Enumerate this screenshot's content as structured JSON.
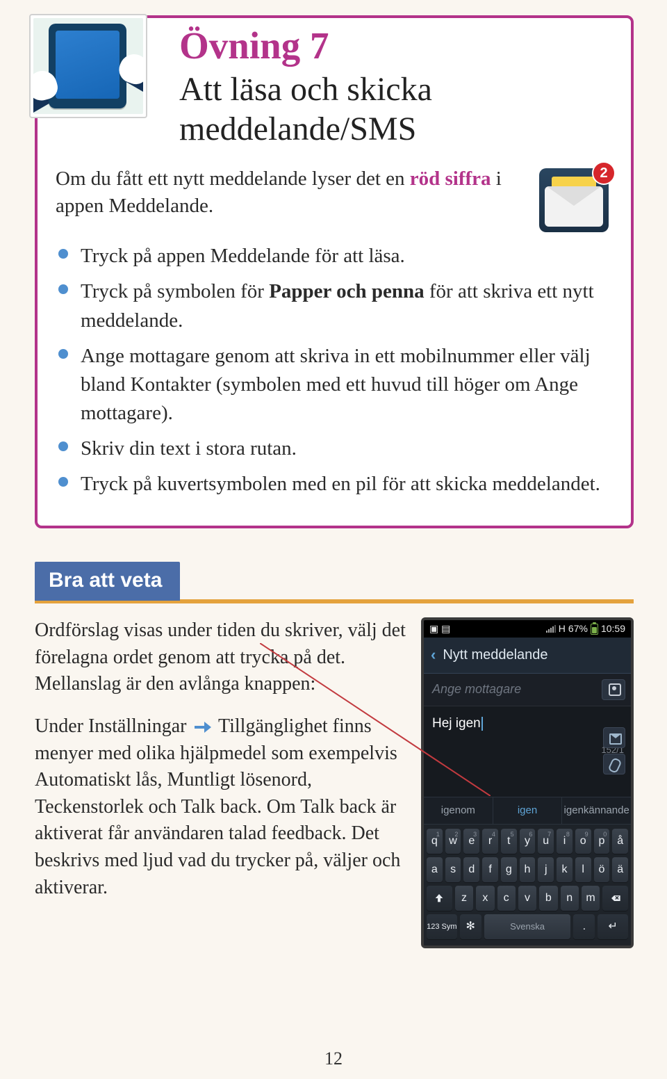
{
  "exercise": {
    "title": "Övning 7",
    "subtitle_l1": "Att läsa och skicka",
    "subtitle_l2": "meddelande/SMS",
    "intro_before": "Om du fått ett nytt meddelande lyser det en ",
    "intro_red": "röd siffra",
    "intro_after": " i appen Meddelande.",
    "bullets": [
      {
        "pre": "Tryck på appen Meddelande för att läsa."
      },
      {
        "pre": "Tryck på symbolen för ",
        "bold": "Papper och penna",
        "post": " för att skriva ett nytt meddelande."
      },
      {
        "pre": "Ange mottagare genom att skriva in ett mobilnummer eller välj bland Kontakter (symbolen med ett huvud till höger om Ange mottagare)."
      },
      {
        "pre": "Skriv din text i stora rutan."
      },
      {
        "pre": "Tryck på kuvertsymbolen med en pil för att skicka meddelandet."
      }
    ],
    "mail_badge_number": "2"
  },
  "know": {
    "heading": "Bra att veta",
    "p1": "Ordförslag visas under tiden du skriver, välj det förelagna ordet genom att trycka på det. Mellanslag är den avlånga knappen:",
    "p2a": "Under Inställningar ",
    "p2b": " Tillgänglighet finns menyer med olika hjälpmedel som exempelvis Automatiskt lås, Muntligt lösenord, Teckenstorlek och Talk back. Om Talk back är aktiverat får användaren talad feedback. Det beskrivs med ljud vad du trycker på, väljer och aktiverar."
  },
  "phone": {
    "status": {
      "battery_pct": "67%",
      "time": "10:59",
      "net": "H"
    },
    "appbar_title": "Nytt meddelande",
    "recipient_placeholder": "Ange mottagare",
    "message_text": "Hej igen",
    "char_count": "152/1",
    "suggestions": [
      "igenom",
      "igen",
      "igenkännande"
    ],
    "kbd_rows": {
      "r1": [
        "q",
        "w",
        "e",
        "r",
        "t",
        "y",
        "u",
        "i",
        "o",
        "p",
        "å"
      ],
      "r2": [
        "a",
        "s",
        "d",
        "f",
        "g",
        "h",
        "j",
        "k",
        "l",
        "ö",
        "ä"
      ],
      "r3": [
        "z",
        "x",
        "c",
        "v",
        "b",
        "n",
        "m"
      ]
    },
    "sym_key": "123 Sym",
    "space_label": "Svenska"
  },
  "page_number": "12"
}
